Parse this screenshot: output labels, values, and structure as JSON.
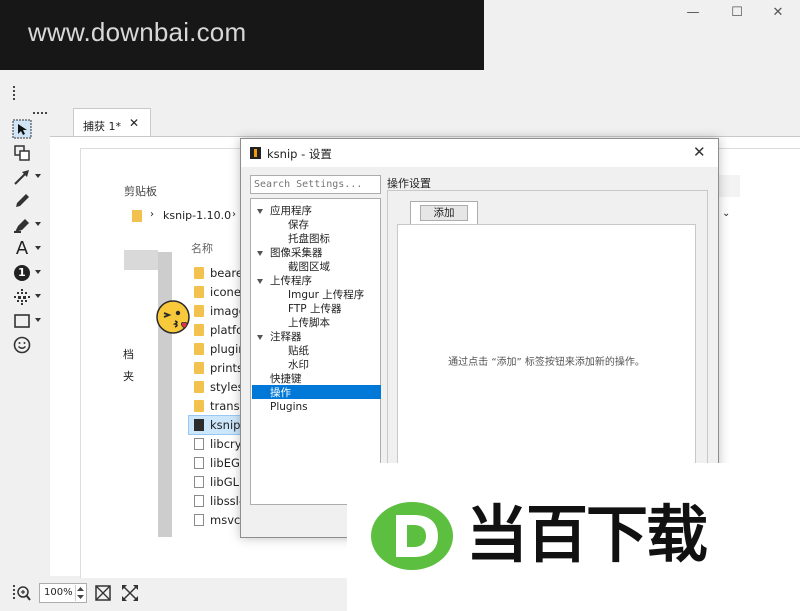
{
  "watermark": {
    "banner_text": "www.downbai.com",
    "brand_text": "当百下载",
    "brand_colors": {
      "green": "#5cbf3f",
      "dark": "#111111"
    }
  },
  "window_controls": {
    "minimize": "—",
    "maximize": "☐",
    "close": "✕"
  },
  "toolbar": {
    "tools": [
      {
        "name": "select-tool-icon"
      },
      {
        "name": "duplicate-region-icon"
      },
      {
        "name": "arrow-tool-icon"
      },
      {
        "name": "pen-tool-icon"
      },
      {
        "name": "marker-tool-icon"
      },
      {
        "name": "text-tool-icon",
        "glyph": "A"
      },
      {
        "name": "number-tool-icon",
        "glyph": "1"
      },
      {
        "name": "blur-tool-icon"
      },
      {
        "name": "rectangle-tool-icon"
      },
      {
        "name": "sticker-tool-icon",
        "glyph": "☺"
      }
    ]
  },
  "main": {
    "tab_label": "捕获 1*",
    "tab_close": "✕"
  },
  "explorer": {
    "clipboard_label": "剪贴板",
    "path_text": "ksnip-1.10.0",
    "name_header": "名称",
    "side_chars": [
      "档",
      "夹"
    ],
    "files": [
      {
        "name": "beare",
        "type": "folder"
      },
      {
        "name": "icone",
        "type": "folder"
      },
      {
        "name": "image",
        "type": "folder"
      },
      {
        "name": "platfo",
        "type": "folder"
      },
      {
        "name": "plugir",
        "type": "folder"
      },
      {
        "name": "prints",
        "type": "folder"
      },
      {
        "name": "styles",
        "type": "folder"
      },
      {
        "name": "transl",
        "type": "folder"
      },
      {
        "name": "ksnip.",
        "type": "exe"
      },
      {
        "name": "libcry",
        "type": "dll"
      },
      {
        "name": "libEGL",
        "type": "dll"
      },
      {
        "name": "libGLE",
        "type": "dll"
      },
      {
        "name": "libssl-",
        "type": "dll"
      },
      {
        "name": "msvcp",
        "type": "dll"
      }
    ]
  },
  "dialog": {
    "title": "ksnip - 设置",
    "search_placeholder": "Search Settings...",
    "tree": {
      "app": "应用程序",
      "save": "保存",
      "tray": "托盘图标",
      "capture": "图像采集器",
      "snip_area": "截图区域",
      "uploader": "上传程序",
      "imgur": "Imgur 上传程序",
      "ftp": "FTP 上传器",
      "script": "上传脚本",
      "annotator": "注释器",
      "sticker": "贴纸",
      "watermark": "水印",
      "hotkeys": "快捷键",
      "actions": "操作",
      "plugins": "Plugins"
    },
    "section_title": "操作设置",
    "add_tab": "添加",
    "empty_message": "通过点击 “添加” 标签按钮来添加新的操作。"
  },
  "status": {
    "zoom_value": "100%"
  }
}
